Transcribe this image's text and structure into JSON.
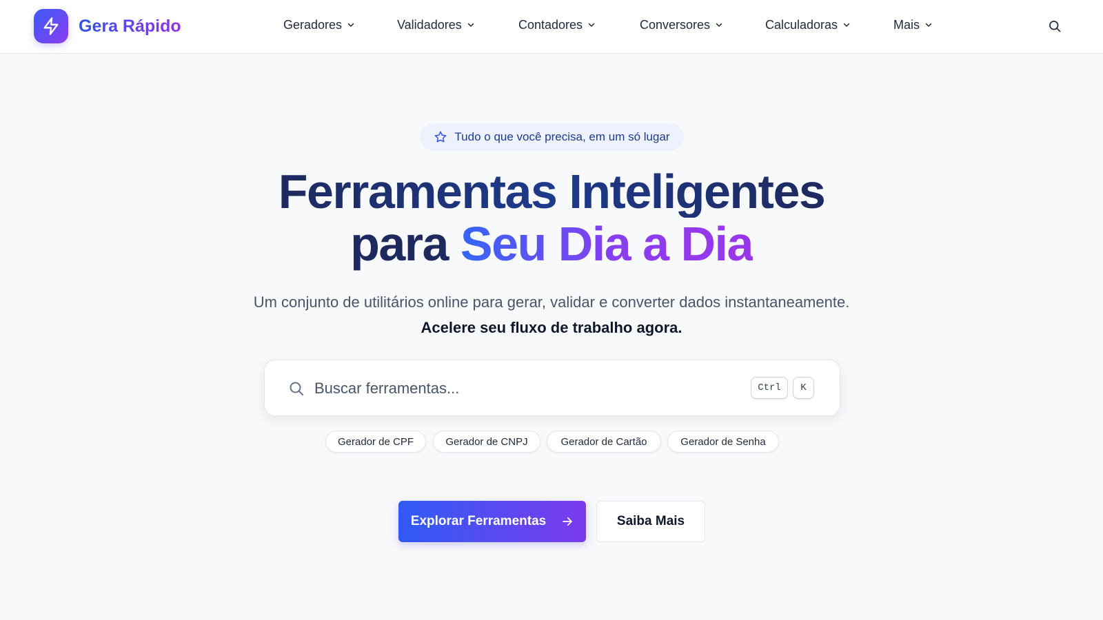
{
  "brand": {
    "name": "Gera Rápido",
    "logo_icon": "lightning-bolt-icon",
    "gradient": [
      "#3b5bf6",
      "#8b3df0"
    ]
  },
  "nav": {
    "items": [
      {
        "label": "Geradores",
        "icon": "chevron-down-icon"
      },
      {
        "label": "Validadores",
        "icon": "chevron-down-icon"
      },
      {
        "label": "Contadores",
        "icon": "chevron-down-icon"
      },
      {
        "label": "Conversores",
        "icon": "chevron-down-icon"
      },
      {
        "label": "Calculadoras",
        "icon": "chevron-down-icon"
      },
      {
        "label": "Mais",
        "icon": "chevron-down-icon"
      }
    ],
    "search_icon": "search-icon"
  },
  "hero": {
    "badge": {
      "icon": "star-icon",
      "text": "Tudo o que você precisa, em um só lugar"
    },
    "title_line1": "Ferramentas Inteligentes",
    "title_line2_plain": "para",
    "title_line2_highlight": "Seu Dia a Dia",
    "subtitle_plain": "Um conjunto de utilitários online para gerar, validar e converter dados instantaneamente.",
    "subtitle_strong": "Acelere seu fluxo de trabalho agora."
  },
  "search": {
    "placeholder": "Buscar ferramentas...",
    "value": "",
    "shortcut_keys": [
      "Ctrl",
      "K"
    ]
  },
  "quick_links": [
    "Gerador de CPF",
    "Gerador de CNPJ",
    "Gerador de Cartão",
    "Gerador de Senha"
  ],
  "cta": {
    "primary_label": "Explorar Ferramentas",
    "primary_icon": "arrow-right-icon",
    "secondary_label": "Saiba Mais"
  },
  "colors": {
    "accent_blue": "#2f5bf5",
    "accent_purple": "#7c3aed",
    "heading_navy": "#1e2a5e",
    "background": "#f8f9fb"
  }
}
